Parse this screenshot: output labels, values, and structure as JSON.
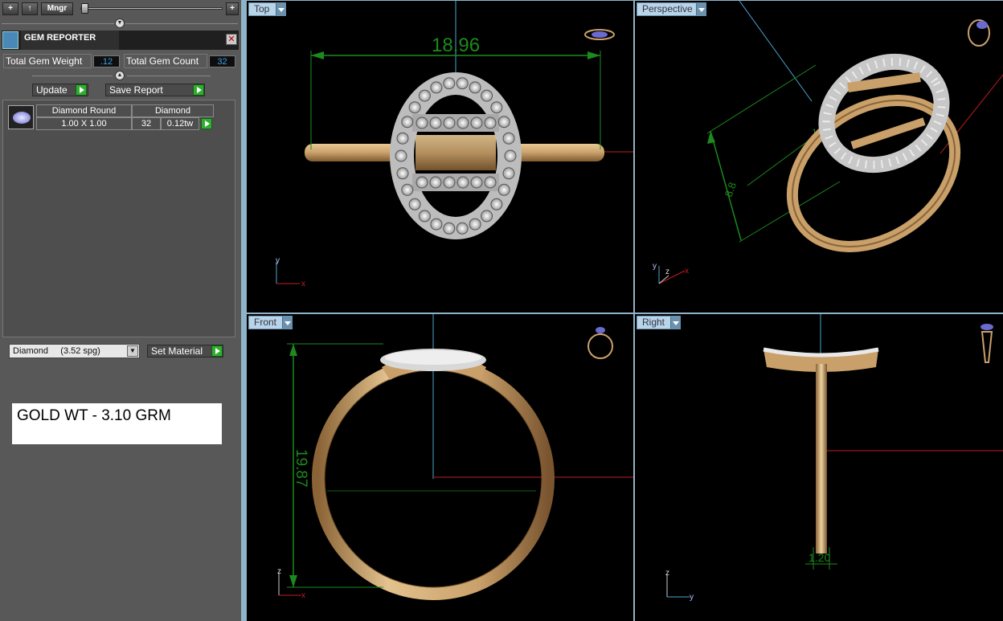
{
  "toolbar": {
    "add_label": "+",
    "up_label": "↑",
    "mngr_label": "Mngr",
    "plus_right_label": "+"
  },
  "gem_reporter": {
    "title": "GEM REPORTER",
    "close_label": "✕",
    "total_gem_weight_label": "Total Gem Weight",
    "total_gem_weight_value": ".12",
    "total_gem_count_label": "Total Gem Count",
    "total_gem_count_value": "32",
    "update_label": "Update",
    "save_report_label": "Save Report",
    "gem_row": {
      "col1_header": "Diamond Round",
      "col2_header": "Diamond",
      "size": "1.00 X 1.00",
      "count": "32",
      "weight": "0.12tw"
    },
    "material_select": "Diamond     (3.52 spg)",
    "set_material_label": "Set Material"
  },
  "gold_weight_text": "GOLD WT - 3.10 GRM",
  "viewports": {
    "top": {
      "label": "Top",
      "dimension": "18.96",
      "axis_y": "y",
      "axis_x": "x"
    },
    "perspective": {
      "label": "Perspective",
      "dimension_a": "1.",
      "dimension_b": "8.8",
      "axis_y": "y",
      "axis_z": "z",
      "axis_x": "x"
    },
    "front": {
      "label": "Front",
      "dimension": "19.87",
      "axis_z": "z",
      "axis_x": "x"
    },
    "right": {
      "label": "Right",
      "dimension": "1.20",
      "axis_z": "z",
      "axis_y": "y"
    }
  },
  "colors": {
    "gold": "#c9a06a",
    "gold_dark": "#8a6436",
    "metal": "#d8d8d8",
    "dim_green": "#1c8a1c",
    "axis_blue": "#4aa8d0",
    "axis_red": "#c0201a",
    "viewport_label": "#b8d4e8"
  }
}
